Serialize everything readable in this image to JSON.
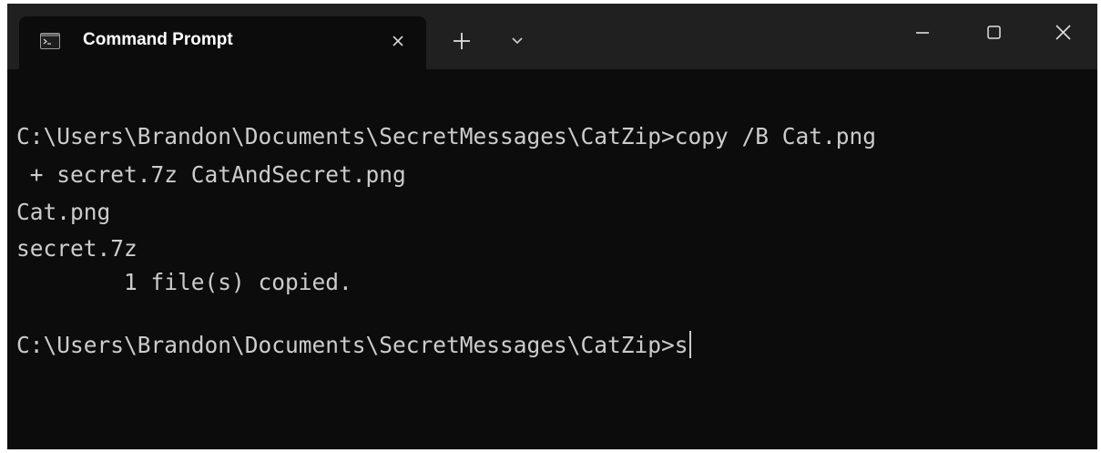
{
  "window": {
    "tab_title": "Command Prompt",
    "controls": {
      "minimize_icon": "minimize-icon",
      "maximize_icon": "maximize-icon",
      "close_icon": "close-icon"
    }
  },
  "console": {
    "lines": [
      "C:\\Users\\Brandon\\Documents\\SecretMessages\\CatZip>copy /B Cat.png",
      " + secret.7z CatAndSecret.png",
      "Cat.png",
      "secret.7z",
      "        1 file(s) copied.",
      "C:\\Users\\Brandon\\Documents\\SecretMessages\\CatZip>s"
    ]
  },
  "colors": {
    "titlebar": "#202020",
    "background": "#0c0c0c",
    "text": "#cccccc"
  }
}
